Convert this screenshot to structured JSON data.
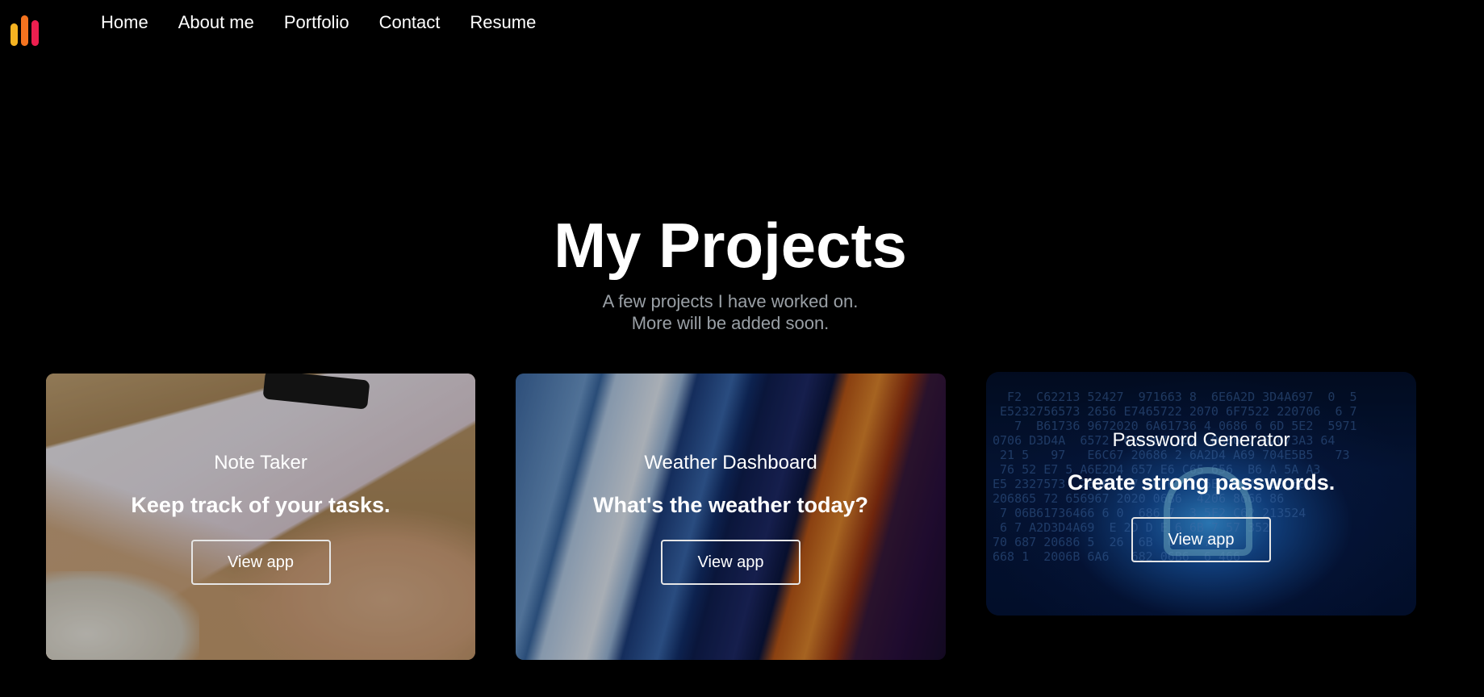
{
  "nav": {
    "items": [
      "Home",
      "About me",
      "Portfolio",
      "Contact",
      "Resume"
    ]
  },
  "logo": {
    "colors": [
      "#f5b321",
      "#f4731f",
      "#ee1f4f"
    ]
  },
  "hero": {
    "title": "My Projects",
    "subtitle_line1": "A few projects I have worked on.",
    "subtitle_line2": "More will be added soon."
  },
  "projects": [
    {
      "title": "Note Taker",
      "tagline": "Keep track of your tasks.",
      "button": "View app"
    },
    {
      "title": "Weather Dashboard",
      "tagline": "What's the weather today?",
      "button": "View app"
    },
    {
      "title": "Password Generator",
      "tagline": "Create strong passwords.",
      "button": "View app"
    }
  ]
}
